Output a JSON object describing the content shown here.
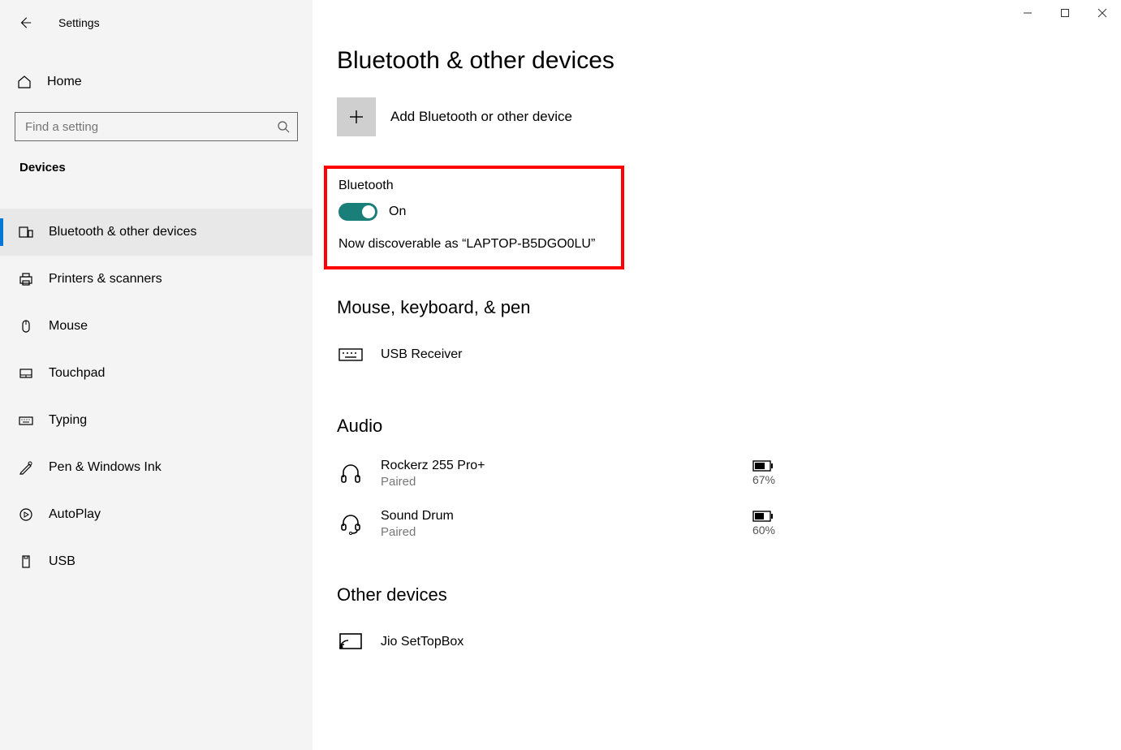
{
  "window": {
    "title": "Settings"
  },
  "sidebar": {
    "home_label": "Home",
    "search_placeholder": "Find a setting",
    "category": "Devices",
    "items": [
      {
        "label": "Bluetooth & other devices",
        "icon": "bluetooth-devices-icon",
        "active": true
      },
      {
        "label": "Printers & scanners",
        "icon": "printer-icon",
        "active": false
      },
      {
        "label": "Mouse",
        "icon": "mouse-icon",
        "active": false
      },
      {
        "label": "Touchpad",
        "icon": "touchpad-icon",
        "active": false
      },
      {
        "label": "Typing",
        "icon": "keyboard-icon",
        "active": false
      },
      {
        "label": "Pen & Windows Ink",
        "icon": "pen-icon",
        "active": false
      },
      {
        "label": "AutoPlay",
        "icon": "autoplay-icon",
        "active": false
      },
      {
        "label": "USB",
        "icon": "usb-icon",
        "active": false
      }
    ]
  },
  "main": {
    "title": "Bluetooth & other devices",
    "add_device_label": "Add Bluetooth or other device",
    "bluetooth": {
      "label": "Bluetooth",
      "state": "On",
      "discoverable": "Now discoverable as “LAPTOP-B5DGO0LU”"
    },
    "sections": {
      "mouse_kbd": {
        "title": "Mouse, keyboard, & pen",
        "devices": [
          {
            "name": "USB Receiver",
            "status": "",
            "icon": "keyboard-device-icon"
          }
        ]
      },
      "audio": {
        "title": "Audio",
        "devices": [
          {
            "name": "Rockerz 255 Pro+",
            "status": "Paired",
            "icon": "headphones-icon",
            "battery": "67%"
          },
          {
            "name": "Sound Drum",
            "status": "Paired",
            "icon": "headset-icon",
            "battery": "60%"
          }
        ]
      },
      "other": {
        "title": "Other devices",
        "devices": [
          {
            "name": "Jio SetTopBox",
            "status": "",
            "icon": "cast-icon"
          }
        ]
      }
    }
  }
}
